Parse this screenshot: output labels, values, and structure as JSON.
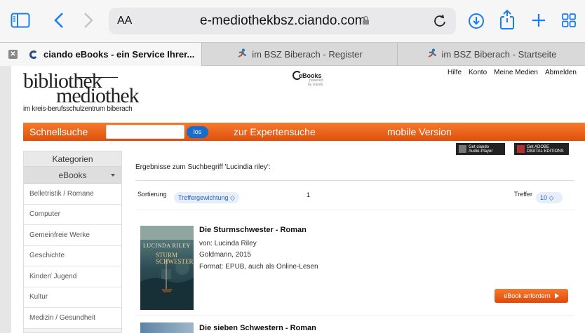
{
  "browser": {
    "text_size_label": "AA",
    "url": "e-mediothekbsz.ciando.com",
    "tabs": [
      {
        "close": "✕",
        "title": "ciando eBooks - ein Service Ihrer..."
      },
      {
        "title": "im BSZ Biberach - Register"
      },
      {
        "title": "im BSZ Biberach - Startseite"
      }
    ]
  },
  "header": {
    "logo_line1": "bibliothek",
    "logo_line2": "mediothek",
    "logo_subtitle": "im kreis-berufsschulzentrum biberach",
    "ebooks_logo": "eBooks",
    "ebooks_powered": "powered",
    "ebooks_by": "by ciando",
    "links": [
      "Hilfe",
      "Konto",
      "Meine Medien",
      "Abmelden"
    ]
  },
  "searchbar": {
    "quick_search_label": "Schnellsuche",
    "search_value": "",
    "go_label": "los",
    "expert_label": "zur Expertensuche",
    "mobile_label": "mobile Version"
  },
  "promos": {
    "audio_line1": "Get ciando",
    "audio_line2": "Audio-Player",
    "adobe_line1": "Get ADOBE",
    "adobe_line2": "DIGITAL EDITIONS"
  },
  "sidebar": {
    "heading": "Kategorien",
    "section": "eBooks",
    "items": [
      "Belletristik / Romane",
      "Computer",
      "Gemeinfreie Werke",
      "Geschichte",
      "Kinder/ Jugend",
      "Kultur",
      "Medizin / Gesundheit"
    ]
  },
  "results": {
    "heading": "Ergebnisse zum Suchbegriff 'Lucindia riley':",
    "sort_label": "Sortierung",
    "sort_value": "Treffergewichtung ◇",
    "page_number": "1",
    "hits_label": "Treffer",
    "hits_value": "10 ◇",
    "items": [
      {
        "title": "Die Sturmschwester - Roman",
        "author": "von: Lucinda Riley",
        "publisher": "Goldmann, 2015",
        "format": "Format: EPUB, auch als Online-Lesen",
        "cover_author": "LUCINDA RILEY",
        "cover_title_1": "STURM",
        "cover_title_2": "SCHWESTER",
        "order_label": "eBook anfordern"
      },
      {
        "title": "Die sieben Schwestern - Roman"
      }
    ]
  },
  "colors": {
    "accent_orange": "#e9611a",
    "safari_blue": "#1a7cf2",
    "pill_blue": "#2863b8"
  }
}
